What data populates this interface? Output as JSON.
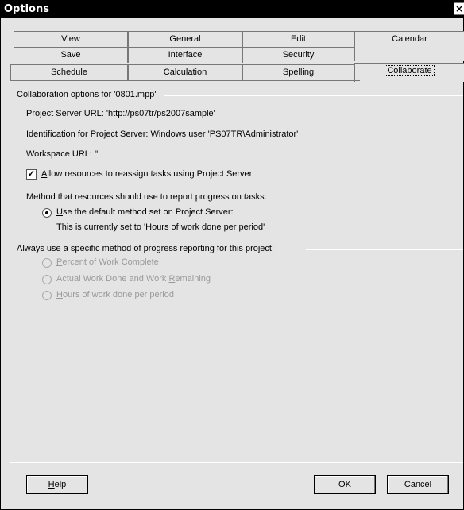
{
  "window": {
    "title": "Options",
    "close_glyph": "×"
  },
  "tabs": {
    "row1": [
      "View",
      "General",
      "Edit",
      "Calendar"
    ],
    "row2": [
      "Save",
      "Interface",
      "Security"
    ],
    "row3": [
      "Schedule",
      "Calculation",
      "Spelling",
      "Collaborate"
    ]
  },
  "collab": {
    "group_title": "Collaboration options for '0801.mpp'",
    "server_url": "Project Server URL: 'http://ps07tr/ps2007sample'",
    "identification": "Identification for Project Server: Windows user 'PS07TR\\Administrator'",
    "workspace_url": "Workspace URL: ''",
    "allow_reassign": {
      "checked": true,
      "pre": "",
      "u": "A",
      "post": "llow resources to reassign tasks using Project Server"
    },
    "method_label": "Method that resources should use to report progress on tasks:",
    "default_method": {
      "checked": true,
      "u": "U",
      "post": "se the default method set on Project Server:"
    },
    "currently_set": "This is currently set to 'Hours of work done per period'",
    "always_label": "Always use a specific method of progress reporting for this project:",
    "options": [
      {
        "u": "P",
        "post": "ercent of Work Complete",
        "pre": ""
      },
      {
        "pre": "Actual Work Done and Work ",
        "u": "R",
        "post": "emaining"
      },
      {
        "pre": "",
        "u": "H",
        "post": "ours of work done per period"
      }
    ]
  },
  "buttons": {
    "help": {
      "u": "H",
      "post": "elp"
    },
    "ok": "OK",
    "cancel": "Cancel"
  }
}
